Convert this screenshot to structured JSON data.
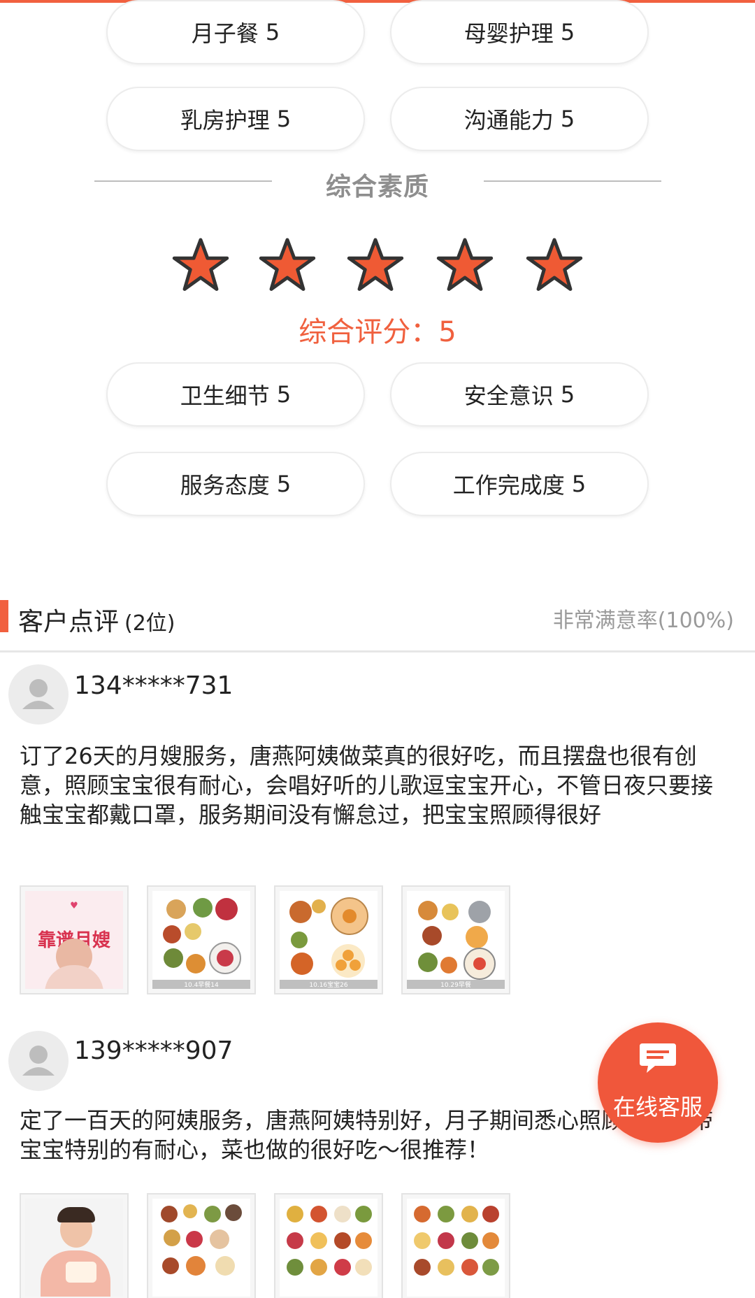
{
  "ratings_top": [
    {
      "label": "月子餐",
      "score": "5"
    },
    {
      "label": "母婴护理",
      "score": "5"
    },
    {
      "label": "乳房护理",
      "score": "5"
    },
    {
      "label": "沟通能力",
      "score": "5"
    }
  ],
  "quality_section": {
    "title": "综合素质",
    "stars_filled": 5,
    "stars_total": 5,
    "star_color": "#ef5a34",
    "overall_text": "综合评分：5"
  },
  "ratings_bottom": [
    {
      "label": "卫生细节",
      "score": "5"
    },
    {
      "label": "安全意识",
      "score": "5"
    },
    {
      "label": "服务态度",
      "score": "5"
    },
    {
      "label": "工作完成度",
      "score": "5"
    }
  ],
  "reviews_section": {
    "title": "客户点评",
    "count": "(2位)",
    "satisfaction": "非常满意率(100%)",
    "accent_color": "#f1603f"
  },
  "reviews": [
    {
      "user": "134*****731",
      "text": "订了26天的月嫂服务，唐燕阿姨做菜真的很好吃，而且摆盘也很有创意，照顾宝宝很有耐心，会唱好听的儿歌逗宝宝开心，不管日夜只要接触宝宝都戴口罩，服务期间没有懈怠过，把宝宝照顾得很好",
      "images": [
        {
          "kind": "profile-poster",
          "caption": "靠谱月嫂"
        },
        {
          "kind": "food",
          "caption": "10.4早餐14"
        },
        {
          "kind": "food",
          "caption": "10.16宝宝26"
        },
        {
          "kind": "food",
          "caption": "10.29早餐"
        }
      ]
    },
    {
      "user": "139*****907",
      "text": "定了一百天的阿姨服务，唐燕阿姨特别好，月子期间悉心照顾宝宝，带宝宝特别的有耐心，菜也做的很好吃～很推荐！",
      "images": [
        {
          "kind": "profile-photo",
          "caption": ""
        },
        {
          "kind": "food",
          "caption": ""
        },
        {
          "kind": "food",
          "caption": ""
        },
        {
          "kind": "food",
          "caption": ""
        }
      ]
    }
  ],
  "online_service": {
    "label": "在线客服",
    "icon": "chat-bubble-icon",
    "color": "#f0573b"
  }
}
